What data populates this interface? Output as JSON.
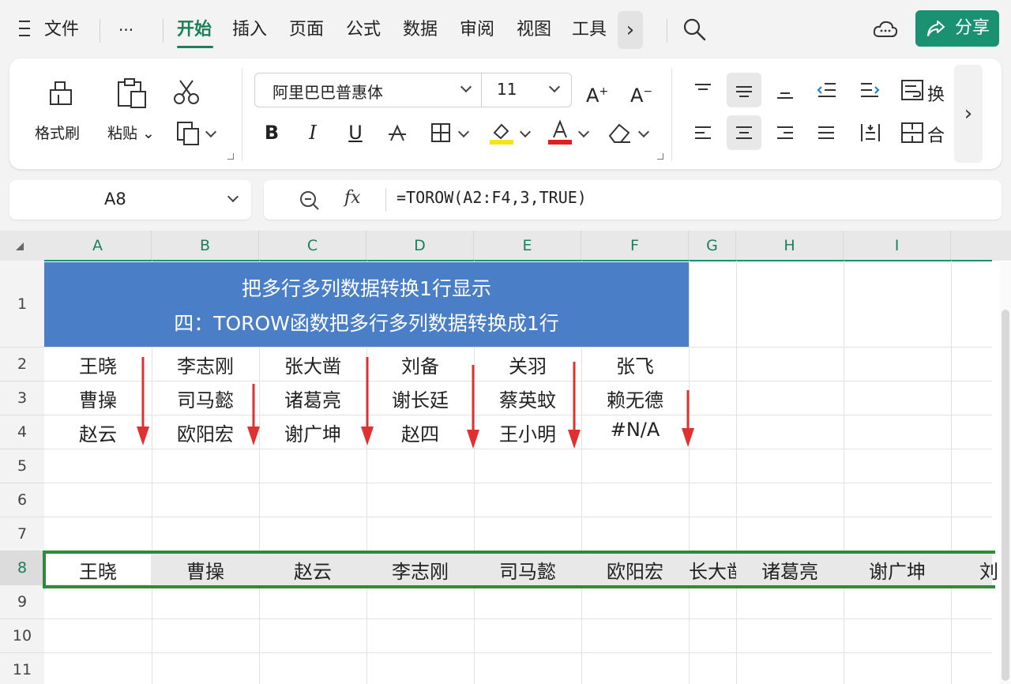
{
  "menubar": {
    "file_label": "文件",
    "more_label": "···",
    "tabs": [
      "开始",
      "插入",
      "页面",
      "公式",
      "数据",
      "审阅",
      "视图",
      "工具"
    ],
    "share_label": "分享",
    "accent_color": "#1a9170"
  },
  "ribbon": {
    "format_painter": "格式刷",
    "paste": "粘贴",
    "font_name": "阿里巴巴普惠体",
    "font_size": "11",
    "bold": "B",
    "italic": "I",
    "underline": "U",
    "wrap_label": "换",
    "merge_label": "合"
  },
  "formula_bar": {
    "cell_ref": "A8",
    "formula": "=TOROW(A2:F4,3,TRUE)"
  },
  "sheet": {
    "columns": [
      "A",
      "B",
      "C",
      "D",
      "E",
      "F",
      "G",
      "H",
      "I"
    ],
    "rows": [
      "1",
      "2",
      "3",
      "4",
      "5",
      "6",
      "7",
      "8",
      "9",
      "10",
      "11"
    ],
    "title_line1": "把多行多列数据转换1行显示",
    "title_line2": "四：TOROW函数把多行多列数据转换成1行",
    "title_fill": "#4a7fc8",
    "data": [
      [
        "王晓",
        "李志刚",
        "张大凿",
        "刘备",
        "关羽",
        "张飞"
      ],
      [
        "曹操",
        "司马懿",
        "诸葛亮",
        "谢长廷",
        "蔡英蚊",
        "赖无德"
      ],
      [
        "赵云",
        "欧阳宏",
        "谢广坤",
        "赵四",
        "王小明",
        "#N/A"
      ]
    ],
    "result_row": [
      "王晓",
      "曹操",
      "赵云",
      "李志刚",
      "司马懿",
      "欧阳宏",
      "长大凿",
      "诸葛亮",
      "谢广坤",
      "刘"
    ],
    "arrow_color": "#e03030",
    "selection_color": "#2e8b3a"
  }
}
